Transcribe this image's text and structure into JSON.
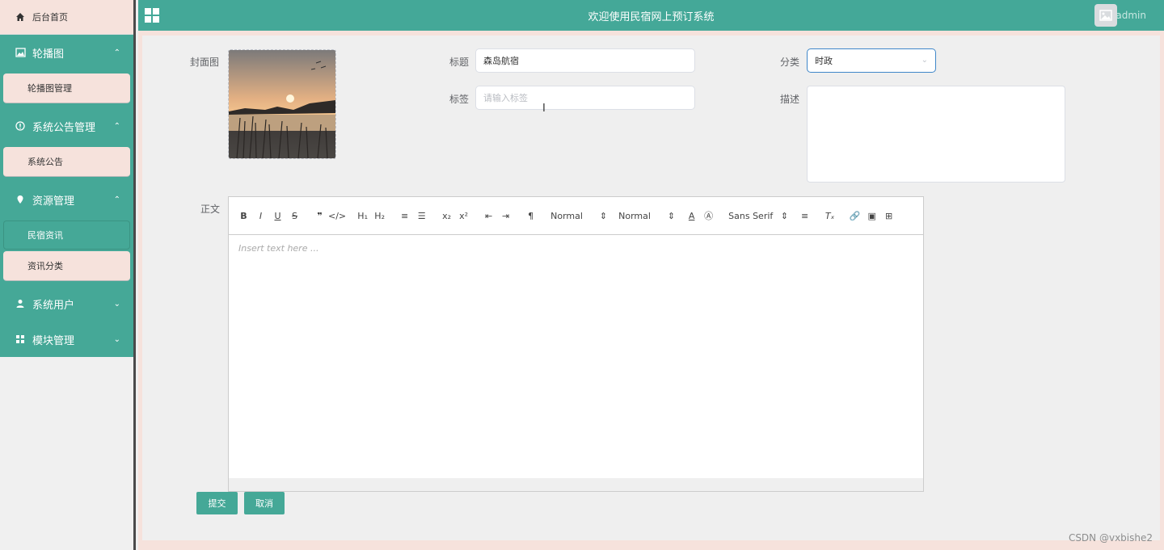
{
  "sidebar": {
    "home": "后台首页",
    "groups": [
      {
        "label": "轮播图",
        "expanded": true,
        "items": [
          {
            "label": "轮播图管理"
          }
        ]
      },
      {
        "label": "系统公告管理",
        "expanded": true,
        "items": [
          {
            "label": "系统公告"
          }
        ]
      },
      {
        "label": "资源管理",
        "expanded": true,
        "items": [
          {
            "label": "民宿资讯",
            "active": true
          },
          {
            "label": "资讯分类"
          }
        ]
      },
      {
        "label": "系统用户",
        "expanded": false
      },
      {
        "label": "模块管理",
        "expanded": false
      }
    ]
  },
  "topbar": {
    "title": "欢迎使用民宿网上预订系统",
    "user": "admin"
  },
  "form": {
    "cover_label": "封面图",
    "title_label": "标题",
    "title_value": "森岛航宿",
    "category_label": "分类",
    "category_value": "时政",
    "tags_label": "标签",
    "tags_placeholder": "请输入标签",
    "desc_label": "描述",
    "desc_value": "",
    "body_label": "正文",
    "editor_placeholder": "Insert text here ...",
    "editor_toolbar": {
      "header": "Normal",
      "size": "Normal",
      "font": "Sans Serif"
    },
    "submit_label": "提交",
    "cancel_label": "取消"
  },
  "watermark": "CSDN @vxbishe2",
  "colors": {
    "primary": "#45a897",
    "sidebar_item_bg": "#f6e2dc",
    "select_border": "#3f87c9"
  }
}
